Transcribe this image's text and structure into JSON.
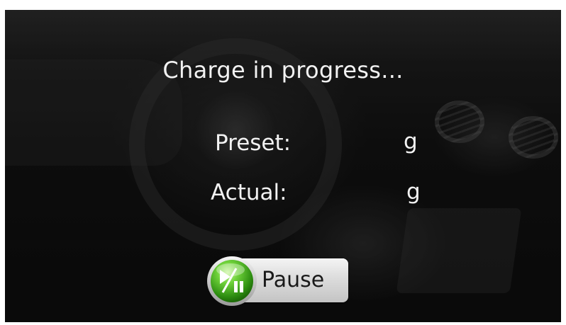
{
  "status": {
    "title": "Charge in progress..."
  },
  "readings": {
    "preset_label": "Preset:",
    "preset_unit": "g",
    "actual_label": "Actual:",
    "actual_unit": "g"
  },
  "controls": {
    "pause_label": "Pause",
    "pause_icon": "play-pause-icon",
    "pause_icon_color": "#5fc12a"
  },
  "theme": {
    "text_color": "#f2f2f2",
    "background_color": "#121212"
  }
}
